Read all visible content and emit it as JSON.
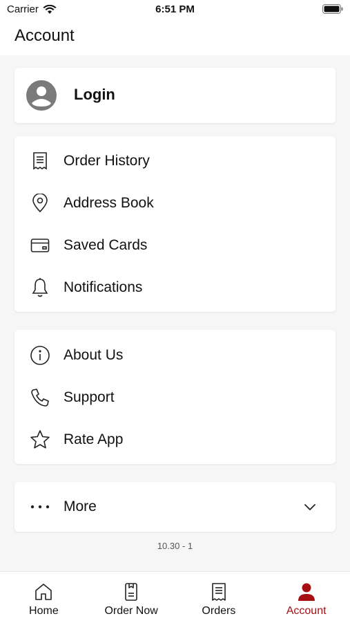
{
  "status": {
    "carrier": "Carrier",
    "time": "6:51 PM"
  },
  "header": {
    "title": "Account"
  },
  "login": {
    "label": "Login"
  },
  "menu_group_1": [
    {
      "label": "Order History",
      "icon": "receipt-icon"
    },
    {
      "label": "Address Book",
      "icon": "location-pin-icon"
    },
    {
      "label": "Saved Cards",
      "icon": "credit-card-icon"
    },
    {
      "label": "Notifications",
      "icon": "bell-icon"
    }
  ],
  "menu_group_2": [
    {
      "label": "About Us",
      "icon": "info-icon"
    },
    {
      "label": "Support",
      "icon": "phone-icon"
    },
    {
      "label": "Rate App",
      "icon": "star-icon"
    }
  ],
  "more": {
    "label": "More",
    "icon": "ellipsis-icon"
  },
  "version": "10.30 - 1",
  "tabs": [
    {
      "label": "Home",
      "icon": "home-icon",
      "active": false
    },
    {
      "label": "Order Now",
      "icon": "order-now-icon",
      "active": false
    },
    {
      "label": "Orders",
      "icon": "orders-icon",
      "active": false
    },
    {
      "label": "Account",
      "icon": "person-icon",
      "active": true
    }
  ],
  "colors": {
    "accent": "#a50f12",
    "background": "#f6f6f6",
    "card": "#ffffff"
  }
}
